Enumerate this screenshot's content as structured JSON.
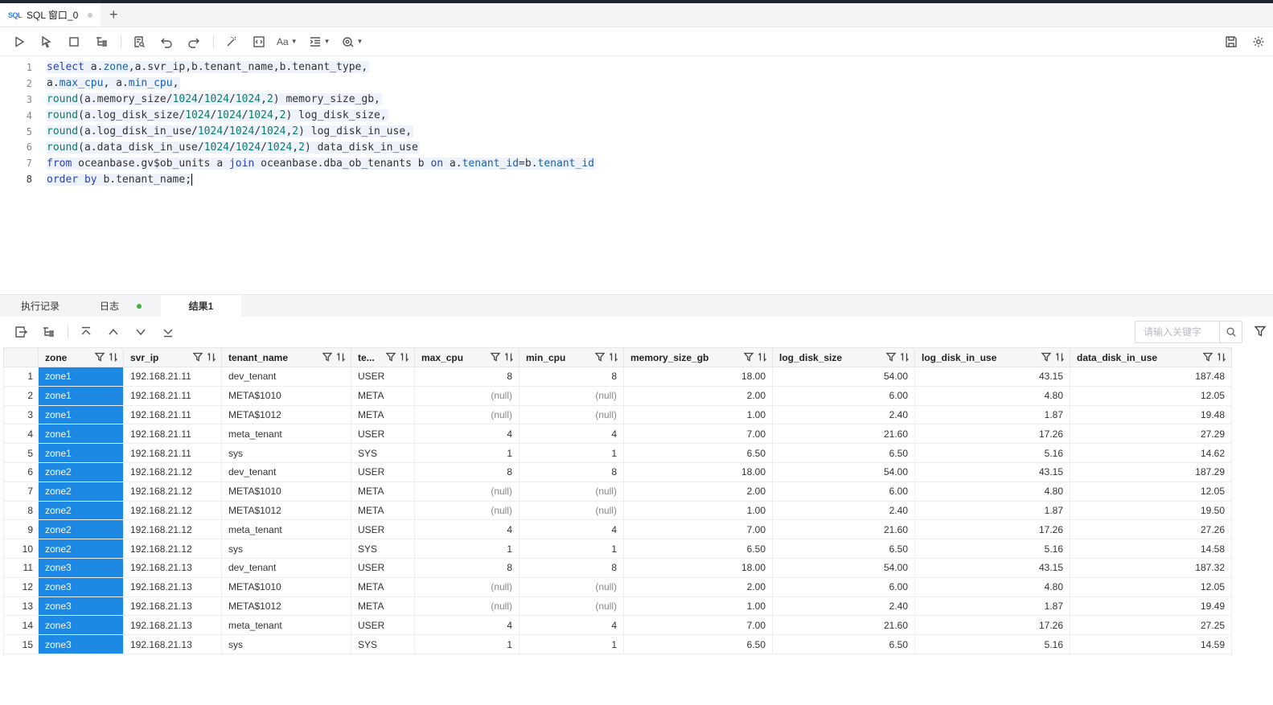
{
  "tab": {
    "icon": "SQL",
    "title": "SQL 窗口_0",
    "add": "+"
  },
  "toolbar": {
    "font_label": "Aa"
  },
  "editor": {
    "lines": [
      {
        "no": "1"
      },
      {
        "no": "2"
      },
      {
        "no": "3"
      },
      {
        "no": "4"
      },
      {
        "no": "5"
      },
      {
        "no": "6"
      },
      {
        "no": "7"
      },
      {
        "no": "8"
      }
    ]
  },
  "result_tabs": [
    {
      "label": "执行记录"
    },
    {
      "label": "日志"
    },
    {
      "label": "结果1"
    }
  ],
  "search": {
    "placeholder": "请输入关键字"
  },
  "colors": {
    "selected": "#1e88e5",
    "keyword": "#2a3ebd",
    "function": "#0a7d6b"
  },
  "table": {
    "columns": [
      "zone",
      "svr_ip",
      "tenant_name",
      "te...",
      "max_cpu",
      "min_cpu",
      "memory_size_gb",
      "log_disk_size",
      "log_disk_in_use",
      "data_disk_in_use"
    ],
    "rows": [
      [
        "1",
        "zone1",
        "192.168.21.11",
        "dev_tenant",
        "USER",
        "8",
        "8",
        "18.00",
        "54.00",
        "43.15",
        "187.48"
      ],
      [
        "2",
        "zone1",
        "192.168.21.11",
        "META$1010",
        "META",
        "(null)",
        "(null)",
        "2.00",
        "6.00",
        "4.80",
        "12.05"
      ],
      [
        "3",
        "zone1",
        "192.168.21.11",
        "META$1012",
        "META",
        "(null)",
        "(null)",
        "1.00",
        "2.40",
        "1.87",
        "19.48"
      ],
      [
        "4",
        "zone1",
        "192.168.21.11",
        "meta_tenant",
        "USER",
        "4",
        "4",
        "7.00",
        "21.60",
        "17.26",
        "27.29"
      ],
      [
        "5",
        "zone1",
        "192.168.21.11",
        "sys",
        "SYS",
        "1",
        "1",
        "6.50",
        "6.50",
        "5.16",
        "14.62"
      ],
      [
        "6",
        "zone2",
        "192.168.21.12",
        "dev_tenant",
        "USER",
        "8",
        "8",
        "18.00",
        "54.00",
        "43.15",
        "187.29"
      ],
      [
        "7",
        "zone2",
        "192.168.21.12",
        "META$1010",
        "META",
        "(null)",
        "(null)",
        "2.00",
        "6.00",
        "4.80",
        "12.05"
      ],
      [
        "8",
        "zone2",
        "192.168.21.12",
        "META$1012",
        "META",
        "(null)",
        "(null)",
        "1.00",
        "2.40",
        "1.87",
        "19.50"
      ],
      [
        "9",
        "zone2",
        "192.168.21.12",
        "meta_tenant",
        "USER",
        "4",
        "4",
        "7.00",
        "21.60",
        "17.26",
        "27.26"
      ],
      [
        "10",
        "zone2",
        "192.168.21.12",
        "sys",
        "SYS",
        "1",
        "1",
        "6.50",
        "6.50",
        "5.16",
        "14.58"
      ],
      [
        "11",
        "zone3",
        "192.168.21.13",
        "dev_tenant",
        "USER",
        "8",
        "8",
        "18.00",
        "54.00",
        "43.15",
        "187.32"
      ],
      [
        "12",
        "zone3",
        "192.168.21.13",
        "META$1010",
        "META",
        "(null)",
        "(null)",
        "2.00",
        "6.00",
        "4.80",
        "12.05"
      ],
      [
        "13",
        "zone3",
        "192.168.21.13",
        "META$1012",
        "META",
        "(null)",
        "(null)",
        "1.00",
        "2.40",
        "1.87",
        "19.49"
      ],
      [
        "14",
        "zone3",
        "192.168.21.13",
        "meta_tenant",
        "USER",
        "4",
        "4",
        "7.00",
        "21.60",
        "17.26",
        "27.25"
      ],
      [
        "15",
        "zone3",
        "192.168.21.13",
        "sys",
        "SYS",
        "1",
        "1",
        "6.50",
        "6.50",
        "5.16",
        "14.59"
      ]
    ]
  }
}
